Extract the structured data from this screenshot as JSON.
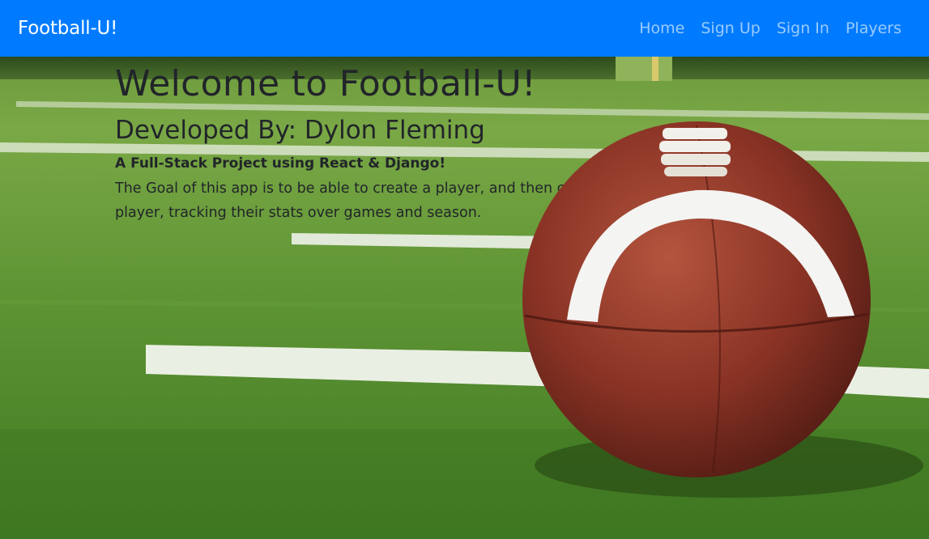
{
  "navbar": {
    "brand": "Football-U!",
    "links": [
      {
        "label": "Home"
      },
      {
        "label": "Sign Up"
      },
      {
        "label": "Sign In"
      },
      {
        "label": "Players"
      }
    ],
    "background_color": "#007bff"
  },
  "hero": {
    "title": "Welcome to Football-U!",
    "subtitle": "Developed By: Dylon Fleming",
    "tagline": "A Full-Stack Project using React & Django!",
    "description": "The Goal of this app is to be able to create a player, and then create GameLogs for that individual player, tracking their stats over games and season.",
    "background_image": "football-on-field"
  }
}
